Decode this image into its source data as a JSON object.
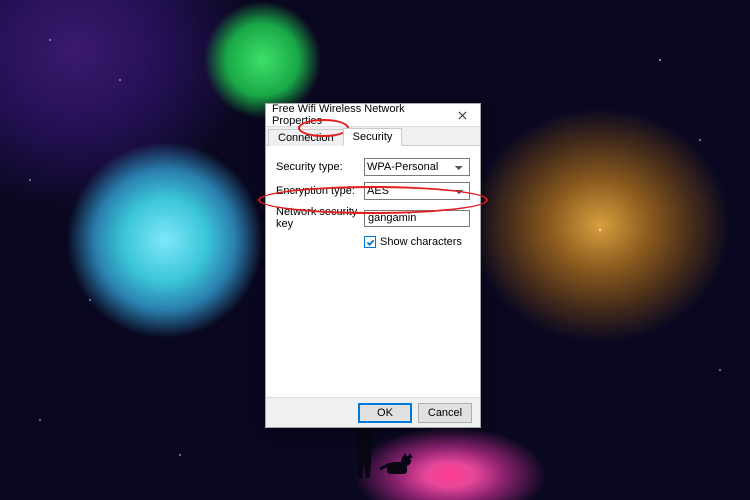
{
  "dialog": {
    "title": "Free Wifi Wireless Network Properties",
    "tabs": {
      "connection": "Connection",
      "security": "Security",
      "active": "security"
    },
    "form": {
      "security_type_label": "Security type:",
      "security_type_value": "WPA-Personal",
      "encryption_label": "Encryption type:",
      "encryption_value": "AES",
      "key_label": "Network security key",
      "key_value": "gangamin",
      "show_characters_label": "Show characters",
      "show_characters_checked": true
    },
    "buttons": {
      "ok": "OK",
      "cancel": "Cancel"
    }
  }
}
